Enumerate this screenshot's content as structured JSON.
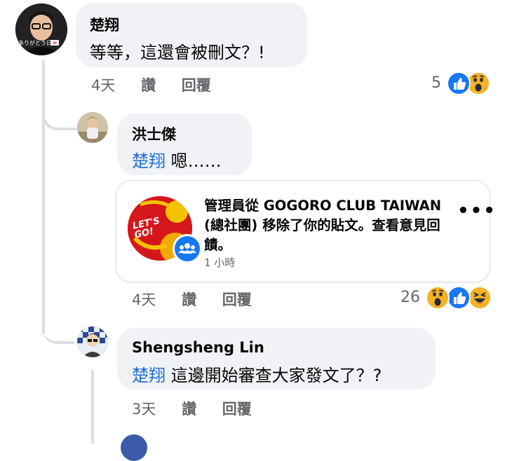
{
  "comments": [
    {
      "author": "楚翔",
      "text": "等等，這還會被刪文？!",
      "time": "4天",
      "like_label": "讚",
      "reply_label": "回覆",
      "reaction_count": "5",
      "reactions": [
        "like-icon",
        "wow-icon"
      ],
      "avatar_text": "ありがとう日本"
    },
    {
      "author": "洪士傑",
      "mention": "楚翔",
      "text": "嗯……",
      "time": "4天",
      "like_label": "讚",
      "reply_label": "回覆",
      "reaction_count": "26",
      "reactions": [
        "wow-icon",
        "like-icon",
        "haha-icon"
      ],
      "card": {
        "message": "管理員從 GOGORO CLUB TAIWAN (總社團) 移除了你的貼文。查看意見回饋。",
        "time": "1 小時",
        "logo_text": "LET'S GO!"
      }
    },
    {
      "author": "Shengsheng Lin",
      "mention": "楚翔",
      "text": "這邊開始審查大家發文了？?",
      "time": "3天",
      "like_label": "讚",
      "reply_label": "回覆"
    }
  ],
  "colors": {
    "bubble": "#f0f2f5",
    "mention": "#216fdb",
    "meta": "#65676b",
    "like": "#1877f2",
    "wow": "#f7b125"
  }
}
